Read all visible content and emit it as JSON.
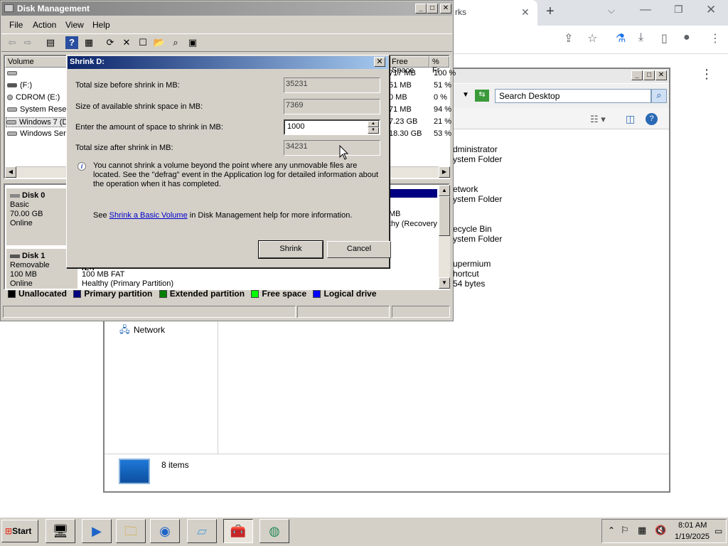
{
  "browser": {
    "tab_title": "rks",
    "tab_close": "✕",
    "new_tab": "+",
    "dropdown": "⌵",
    "minimize": "—",
    "restore": "❐",
    "close": "✕",
    "toolbar_icons": [
      "share-icon",
      "star-icon",
      "lab-icon",
      "download-icon",
      "sidebar-icon",
      "profile-icon",
      "menu-icon"
    ]
  },
  "explorer": {
    "search_placeholder": "Search Desktop",
    "items": [
      {
        "line1": "dministrator",
        "line2": "ystem Folder"
      },
      {
        "line1": "etwork",
        "line2": "ystem Folder"
      },
      {
        "line1": "ecycle Bin",
        "line2": "ystem Folder"
      },
      {
        "line1": "upermium",
        "line2": "hortcut",
        "line3": "54 bytes"
      }
    ],
    "nav_network": "Network",
    "status_count": "8 items"
  },
  "disk_mgmt": {
    "title": "Disk Management",
    "menu": [
      "File",
      "Action",
      "View",
      "Help"
    ],
    "columns": [
      "Volume",
      "Free Space",
      "% Fr"
    ],
    "volumes": [
      {
        "name": "",
        "free": "717 MB",
        "pct": "100 %"
      },
      {
        "name": "(F:)",
        "free": "51 MB",
        "pct": "51 %"
      },
      {
        "name": "CDROM (E:)",
        "free": "0 MB",
        "pct": "0 %"
      },
      {
        "name": "System Reser",
        "free": "71 MB",
        "pct": "94 %"
      },
      {
        "name": "Windows 7 (D",
        "free": "7.23 GB",
        "pct": "21 %"
      },
      {
        "name": "Windows Serv",
        "free": "18.30 GB",
        "pct": "53 %"
      }
    ],
    "disk0": {
      "name": "Disk 0",
      "type": "Basic",
      "size": "70.00 GB",
      "state": "Online"
    },
    "disk1": {
      "name": "Disk 1",
      "type": "Removable",
      "size": "100 MB",
      "state": "Online",
      "part_size": "100 MB FAT",
      "part_health": "Healthy (Primary Partition)",
      "part_letter": "(F:)"
    },
    "graph_right": {
      "mb": "MB",
      "recovery": "thy (Recovery"
    },
    "legend": [
      {
        "label": "Unallocated",
        "color": "#000000"
      },
      {
        "label": "Primary partition",
        "color": "#000080"
      },
      {
        "label": "Extended partition",
        "color": "#008000"
      },
      {
        "label": "Free space",
        "color": "#00ff00"
      },
      {
        "label": "Logical drive",
        "color": "#0000ff"
      }
    ]
  },
  "dialog": {
    "title": "Shrink D:",
    "close": "✕",
    "rows": [
      {
        "label": "Total size before shrink in MB:",
        "value": "35231"
      },
      {
        "label": "Size of available shrink space in MB:",
        "value": "7369"
      },
      {
        "label": "Enter the amount of space to shrink in MB:",
        "value": "1000"
      },
      {
        "label": "Total size after shrink in MB:",
        "value": "34231"
      }
    ],
    "info": "You cannot shrink a volume beyond the point where any unmovable files are located. See the \"defrag\" event in the Application log for detailed information about the operation when it has completed.",
    "see_prefix": "See ",
    "see_link": "Shrink a Basic Volume",
    "see_suffix": " in Disk Management help for more information.",
    "shrink_btn": "Shrink",
    "cancel_btn": "Cancel"
  },
  "taskbar": {
    "start": "Start",
    "time": "8:01 AM",
    "date": "1/19/2025"
  }
}
